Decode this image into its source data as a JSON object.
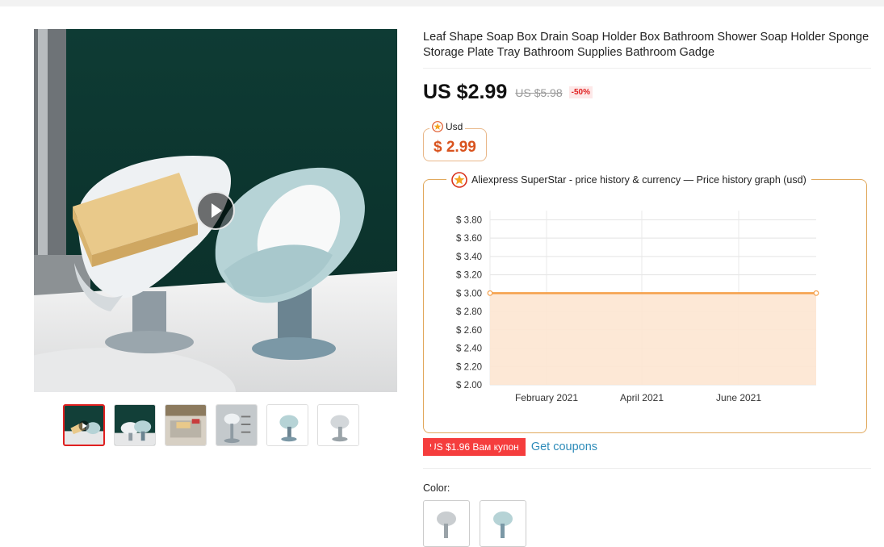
{
  "product": {
    "title": "Leaf Shape Soap Box Drain Soap Holder Box Bathroom Shower Soap Holder Sponge Storage Plate Tray Bathroom Supplies Bathroom Gadge",
    "price_current": "US $2.99",
    "price_original": "US $5.98",
    "discount": "-50%"
  },
  "currency_widget": {
    "label": "Usd",
    "price": "$ 2.99"
  },
  "graph": {
    "legend": "Aliexpress SuperStar - price history & currency — Price history graph (usd)"
  },
  "chart_data": {
    "type": "area",
    "y_tick_labels": [
      "$ 3.80",
      "$ 3.60",
      "$ 3.40",
      "$ 3.20",
      "$ 3.00",
      "$ 2.80",
      "$ 2.60",
      "$ 2.40",
      "$ 2.20",
      "$ 2.00"
    ],
    "y_ticks": [
      3.8,
      3.6,
      3.4,
      3.2,
      3.0,
      2.8,
      2.6,
      2.4,
      2.2,
      2.0
    ],
    "ylim": [
      2.0,
      3.9
    ],
    "x_tick_labels": [
      "February 2021",
      "April 2021",
      "June 2021"
    ],
    "series": [
      {
        "values": [
          3.0,
          3.0
        ],
        "color": "#f5a04a"
      }
    ],
    "grid": true
  },
  "coupon": {
    "badge": "US $1.96 Вам купон",
    "link": "Get coupons"
  },
  "options": {
    "color_label": "Color:"
  },
  "colors": {
    "accent": "#f53d3d",
    "link": "#2d8bb9",
    "chart_line": "#f5a04a",
    "chart_fill": "#fde6d2"
  }
}
